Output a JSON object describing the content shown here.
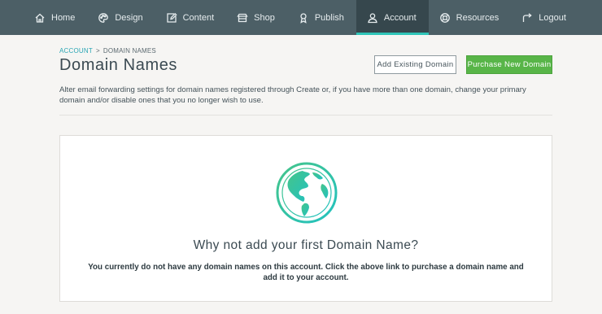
{
  "nav": {
    "items": [
      {
        "label": "Home",
        "icon": "home-icon"
      },
      {
        "label": "Design",
        "icon": "palette-icon"
      },
      {
        "label": "Content",
        "icon": "edit-icon"
      },
      {
        "label": "Shop",
        "icon": "shop-icon"
      },
      {
        "label": "Publish",
        "icon": "publish-icon"
      },
      {
        "label": "Account",
        "icon": "user-icon",
        "active": true
      },
      {
        "label": "Resources",
        "icon": "lifebuoy-icon"
      },
      {
        "label": "Logout",
        "icon": "logout-icon"
      }
    ],
    "accent_color": "#2fc5b8"
  },
  "breadcrumb": {
    "parent": "ACCOUNT",
    "separator": ">",
    "current": "DOMAIN NAMES"
  },
  "page": {
    "title": "Domain Names",
    "description": "Alter email forwarding settings for domain names registered through Create or, if you have more than one domain, change your primary domain and/or disable ones that you no longer wish to use."
  },
  "actions": {
    "add_existing": "Add Existing Domain",
    "purchase_new": "Purchase New Domain",
    "purchase_color": "#58b548"
  },
  "empty_state": {
    "icon": "globe-icon",
    "title": "Why not add your first Domain Name?",
    "message": "You currently do not have any domain names on this account. Click the above link to purchase a domain name and add it to your account."
  }
}
